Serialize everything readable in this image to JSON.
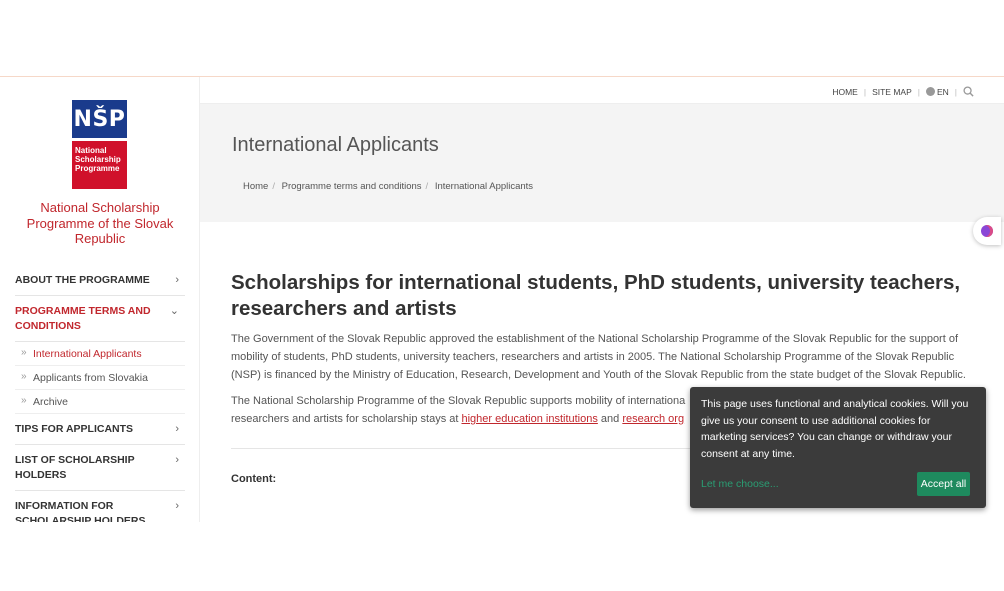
{
  "topbar": {
    "home": "HOME",
    "sitemap": "SITE MAP",
    "lang": "EN"
  },
  "logo": {
    "mark": "NŠP",
    "line1": "National",
    "line2": "Scholarship",
    "line3": "Programme"
  },
  "org_name": "National Scholarship Programme of the Slovak Republic",
  "nav": {
    "about": "ABOUT THE PROGRAMME",
    "terms": "PROGRAMME TERMS AND CONDITIONS",
    "terms_sub": [
      "International Applicants",
      "Applicants from Slovakia",
      "Archive"
    ],
    "tips": "TIPS FOR APPLICANTS",
    "list": "LIST OF SCHOLARSHIP HOLDERS",
    "info": "INFORMATION FOR SCHOLARSHIP HOLDERS"
  },
  "header": {
    "title": "International Applicants",
    "breadcrumb": [
      "Home",
      "Programme terms and conditions",
      "International Applicants"
    ]
  },
  "main": {
    "title": "Scholarships for international students, PhD students, university teachers, researchers and artists",
    "para1": "The Government of the Slovak Republic approved the establishment of the National Scholarship Programme of the Slovak Republic for the support of mobility of students, PhD students, university teachers, researchers and artists in 2005. The National Scholarship Programme of the Slovak Republic (NSP) is financed by the Ministry of Education, Research, Development and Youth of the Slovak Republic from the state budget of the Slovak Republic.",
    "para2_start": "The National Scholarship Programme of the Slovak Republic supports mobility of internationa",
    "para2_line2": "researchers and artists for scholarship stays at ",
    "link1": "higher education institutions",
    "and": " and ",
    "link2": "research org",
    "content_label": "Content:"
  },
  "cookie": {
    "text": "This page uses functional and analytical cookies. Will you give us your consent to use additional cookies for marketing services? You can change or withdraw your consent at any time.",
    "choose": "Let me choose...",
    "accept": "Accept all"
  },
  "colors": {
    "brand_red": "#c1272d",
    "brand_blue": "#1a3b8c",
    "accept_green": "#1e8a5e"
  }
}
